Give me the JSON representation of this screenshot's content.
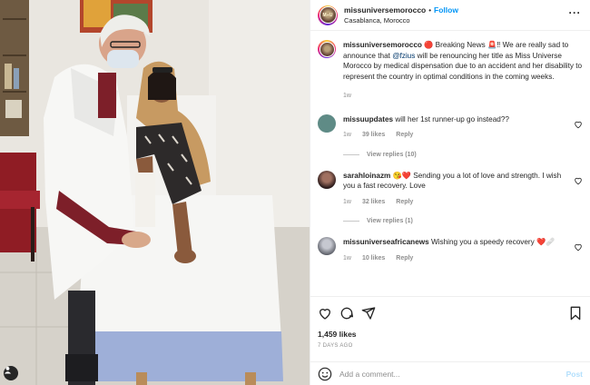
{
  "header": {
    "username": "missuniversemorocco",
    "separator": "•",
    "follow_label": "Follow",
    "location": "Casablanca, Morocco",
    "avatar_text": "M⋆U"
  },
  "caption": {
    "username": "missuniversemorocco",
    "text_pre": " 🔴 Breaking News 🚨‼ We are really sad to announce that ",
    "mention": "@fzius",
    "text_post": " will be renouncing her title as Miss Universe Morocco by medical dispensation due to an accident and her disability to represent the country in optimal conditions in the coming weeks.",
    "time": "1w"
  },
  "comments": [
    {
      "username": "missuupdates",
      "text": " will her 1st runner-up go instead??",
      "time": "1w",
      "likes": "39 likes",
      "reply": "Reply",
      "view_replies": "View replies (10)",
      "avatar_color": "#5f8b86"
    },
    {
      "username": "sarahloinazm",
      "text": " 😘❤️ Sending you a lot of love and strength. I wish you a fast recovery. Love",
      "time": "1w",
      "likes": "32 likes",
      "reply": "Reply",
      "view_replies": "View replies (1)",
      "avatar_color": "#3b2a2a"
    },
    {
      "username": "missuniverseafricanews",
      "text": " Wishing you a speedy recovery ❤️🩹",
      "time": "1w",
      "likes": "10 likes",
      "reply": "Reply",
      "avatar_color": "#6c6f78"
    }
  ],
  "actions": {
    "likes": "1,459 likes",
    "date": "7 DAYS AGO"
  },
  "add_comment": {
    "placeholder": "Add a comment...",
    "post_label": "Post"
  },
  "colors": {
    "accent": "#0095f6",
    "muted": "#8e8e8e",
    "text": "#262626"
  }
}
